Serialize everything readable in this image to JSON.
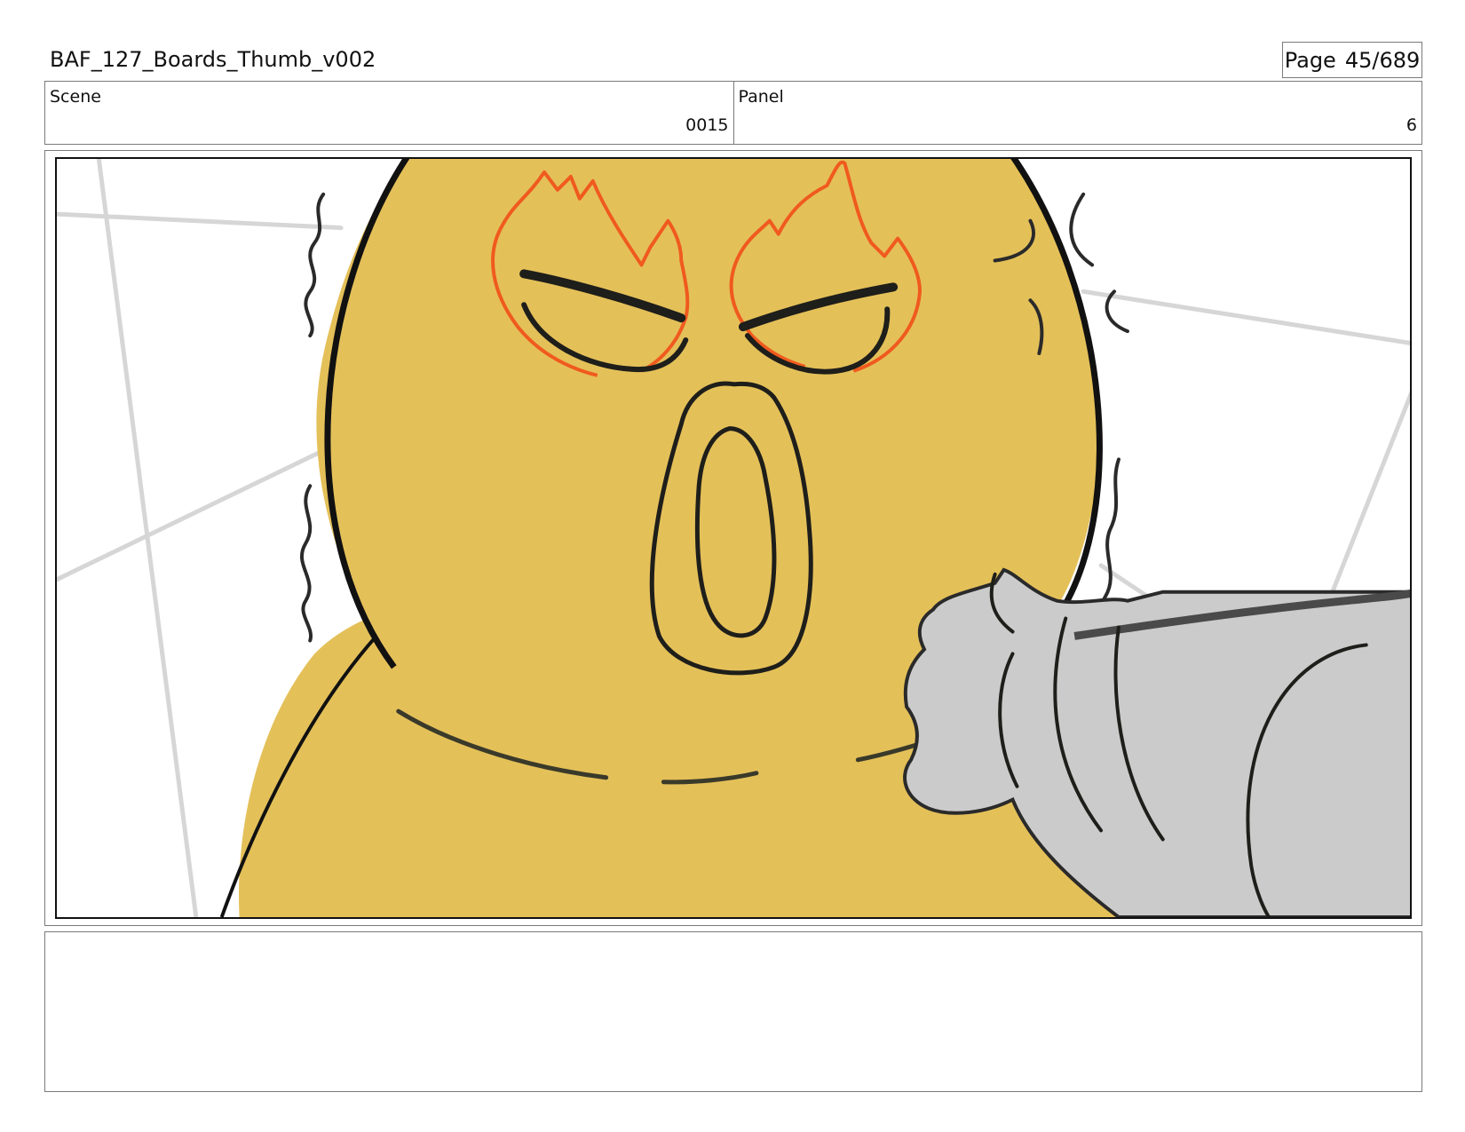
{
  "document": {
    "title": "BAF_127_Boards_Thumb_v002",
    "page_label": "Page",
    "page_number": "45/689"
  },
  "info": {
    "scene_label": "Scene",
    "scene_value": "0015",
    "panel_label": "Panel",
    "panel_value": "6"
  },
  "panel_image": {
    "colors": {
      "character_fill": "#E4C059",
      "outline": "#111111",
      "anger_flames": "#F05A1E",
      "fist_fill": "#CBCBCB",
      "background_lines": "#D6D6D6"
    },
    "icons": [
      "angry-face-drawing",
      "fist-drawing",
      "anger-flame-icon",
      "shake-line-icon"
    ]
  },
  "notes": {
    "text": ""
  }
}
